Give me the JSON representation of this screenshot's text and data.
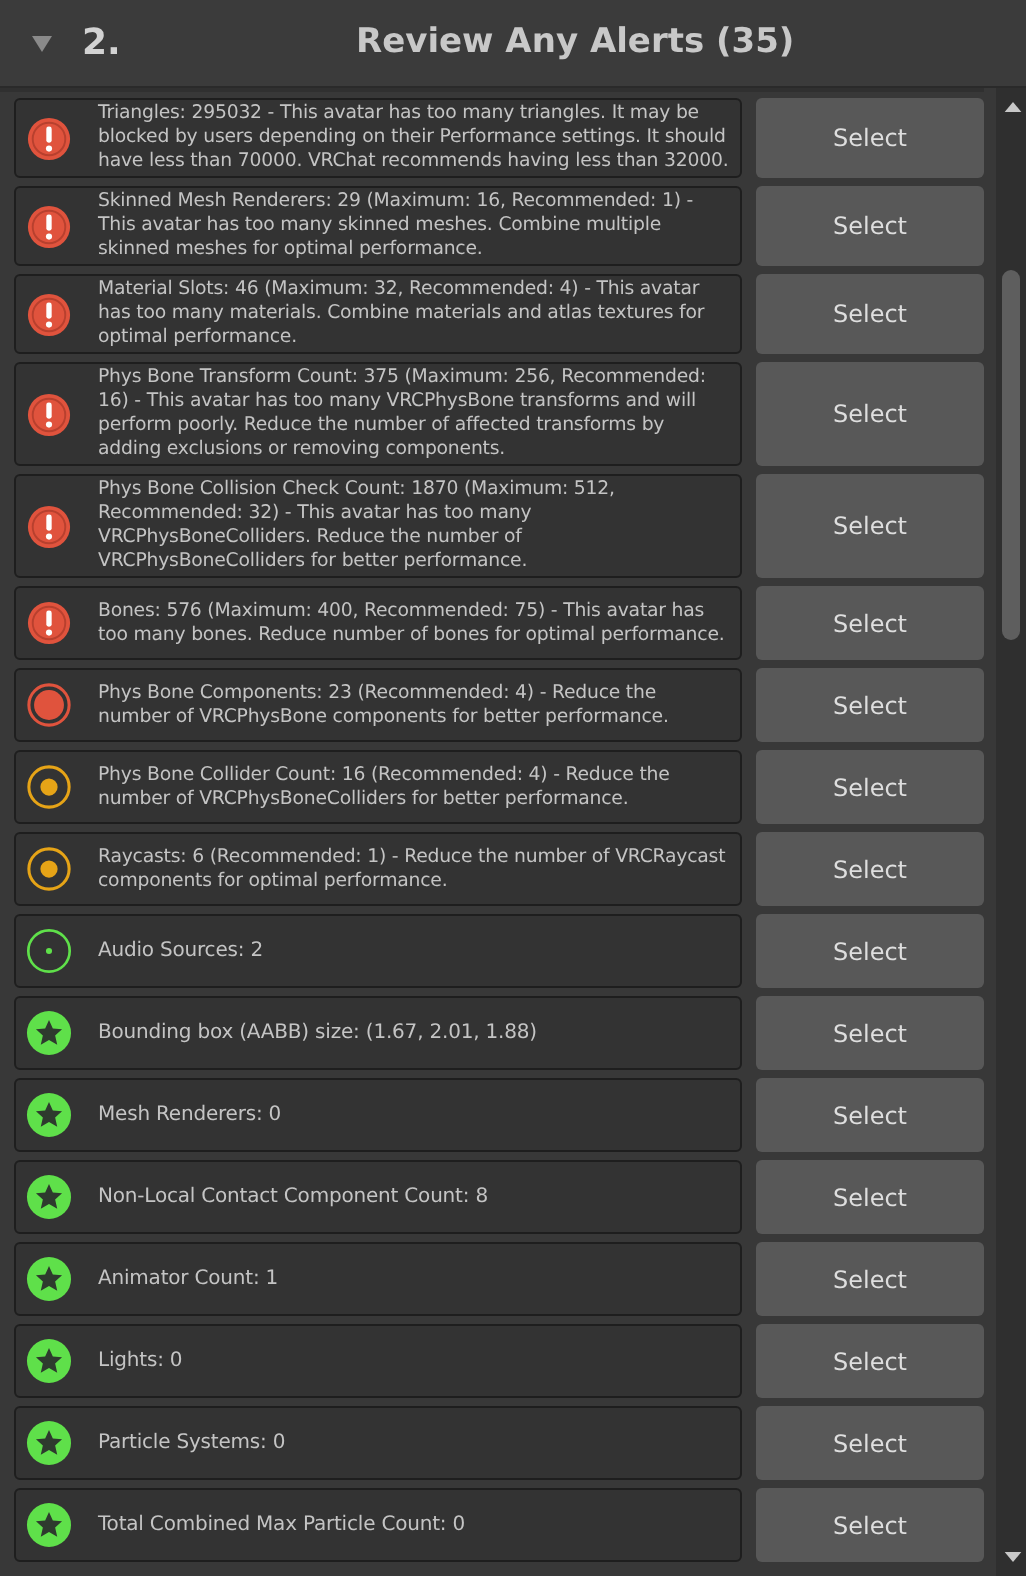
{
  "section": {
    "number": "2.",
    "title": "Review Any Alerts (35)",
    "expanded": true
  },
  "alerts": [
    {
      "kind": "very_poor",
      "message": "Triangles: 295032 - This avatar has too many triangles. It may be blocked by users depending on their Performance settings. It should have less than 70000. VRChat recommends having less than 32000.",
      "button": "Select"
    },
    {
      "kind": "very_poor",
      "message": "Skinned Mesh Renderers: 29 (Maximum: 16, Recommended: 1) - This avatar has too many skinned meshes. Combine multiple skinned meshes for optimal performance.",
      "button": "Select"
    },
    {
      "kind": "very_poor",
      "message": "Material Slots: 46 (Maximum: 32, Recommended: 4) - This avatar has too many materials. Combine materials and atlas textures for optimal performance.",
      "button": "Select"
    },
    {
      "kind": "very_poor",
      "message": "Phys Bone Transform Count: 375 (Maximum: 256, Recommended: 16) - This avatar has too many VRCPhysBone transforms and will perform poorly. Reduce the number of affected transforms by adding exclusions or removing components.",
      "button": "Select"
    },
    {
      "kind": "very_poor",
      "message": "Phys Bone Collision Check Count: 1870 (Maximum: 512, Recommended: 32) - This avatar has too many VRCPhysBoneColliders. Reduce the number of VRCPhysBoneColliders for better performance.",
      "button": "Select"
    },
    {
      "kind": "very_poor",
      "message": "Bones: 576 (Maximum: 400, Recommended: 75) - This avatar has too many bones. Reduce number of bones for optimal performance.",
      "button": "Select"
    },
    {
      "kind": "poor",
      "message": "Phys Bone Components: 23 (Recommended: 4) - Reduce the number of VRCPhysBone components for better performance.",
      "button": "Select"
    },
    {
      "kind": "medium",
      "message": "Phys Bone Collider Count: 16 (Recommended: 4) - Reduce the number of VRCPhysBoneColliders for better performance.",
      "button": "Select"
    },
    {
      "kind": "medium",
      "message": "Raycasts: 6 (Recommended: 1) - Reduce the number of VRCRaycast components for optimal performance.",
      "button": "Select"
    },
    {
      "kind": "good",
      "message": "Audio Sources: 2",
      "button": "Select"
    },
    {
      "kind": "excellent",
      "message": "Bounding box (AABB) size: (1.67, 2.01, 1.88)",
      "button": "Select"
    },
    {
      "kind": "excellent",
      "message": "Mesh Renderers: 0",
      "button": "Select"
    },
    {
      "kind": "excellent",
      "message": "Non-Local Contact Component Count: 8",
      "button": "Select"
    },
    {
      "kind": "excellent",
      "message": "Animator Count: 1",
      "button": "Select"
    },
    {
      "kind": "excellent",
      "message": "Lights: 0",
      "button": "Select"
    },
    {
      "kind": "excellent",
      "message": "Particle Systems: 0",
      "button": "Select"
    },
    {
      "kind": "excellent",
      "message": "Total Combined Max Particle Count: 0",
      "button": "Select"
    }
  ]
}
